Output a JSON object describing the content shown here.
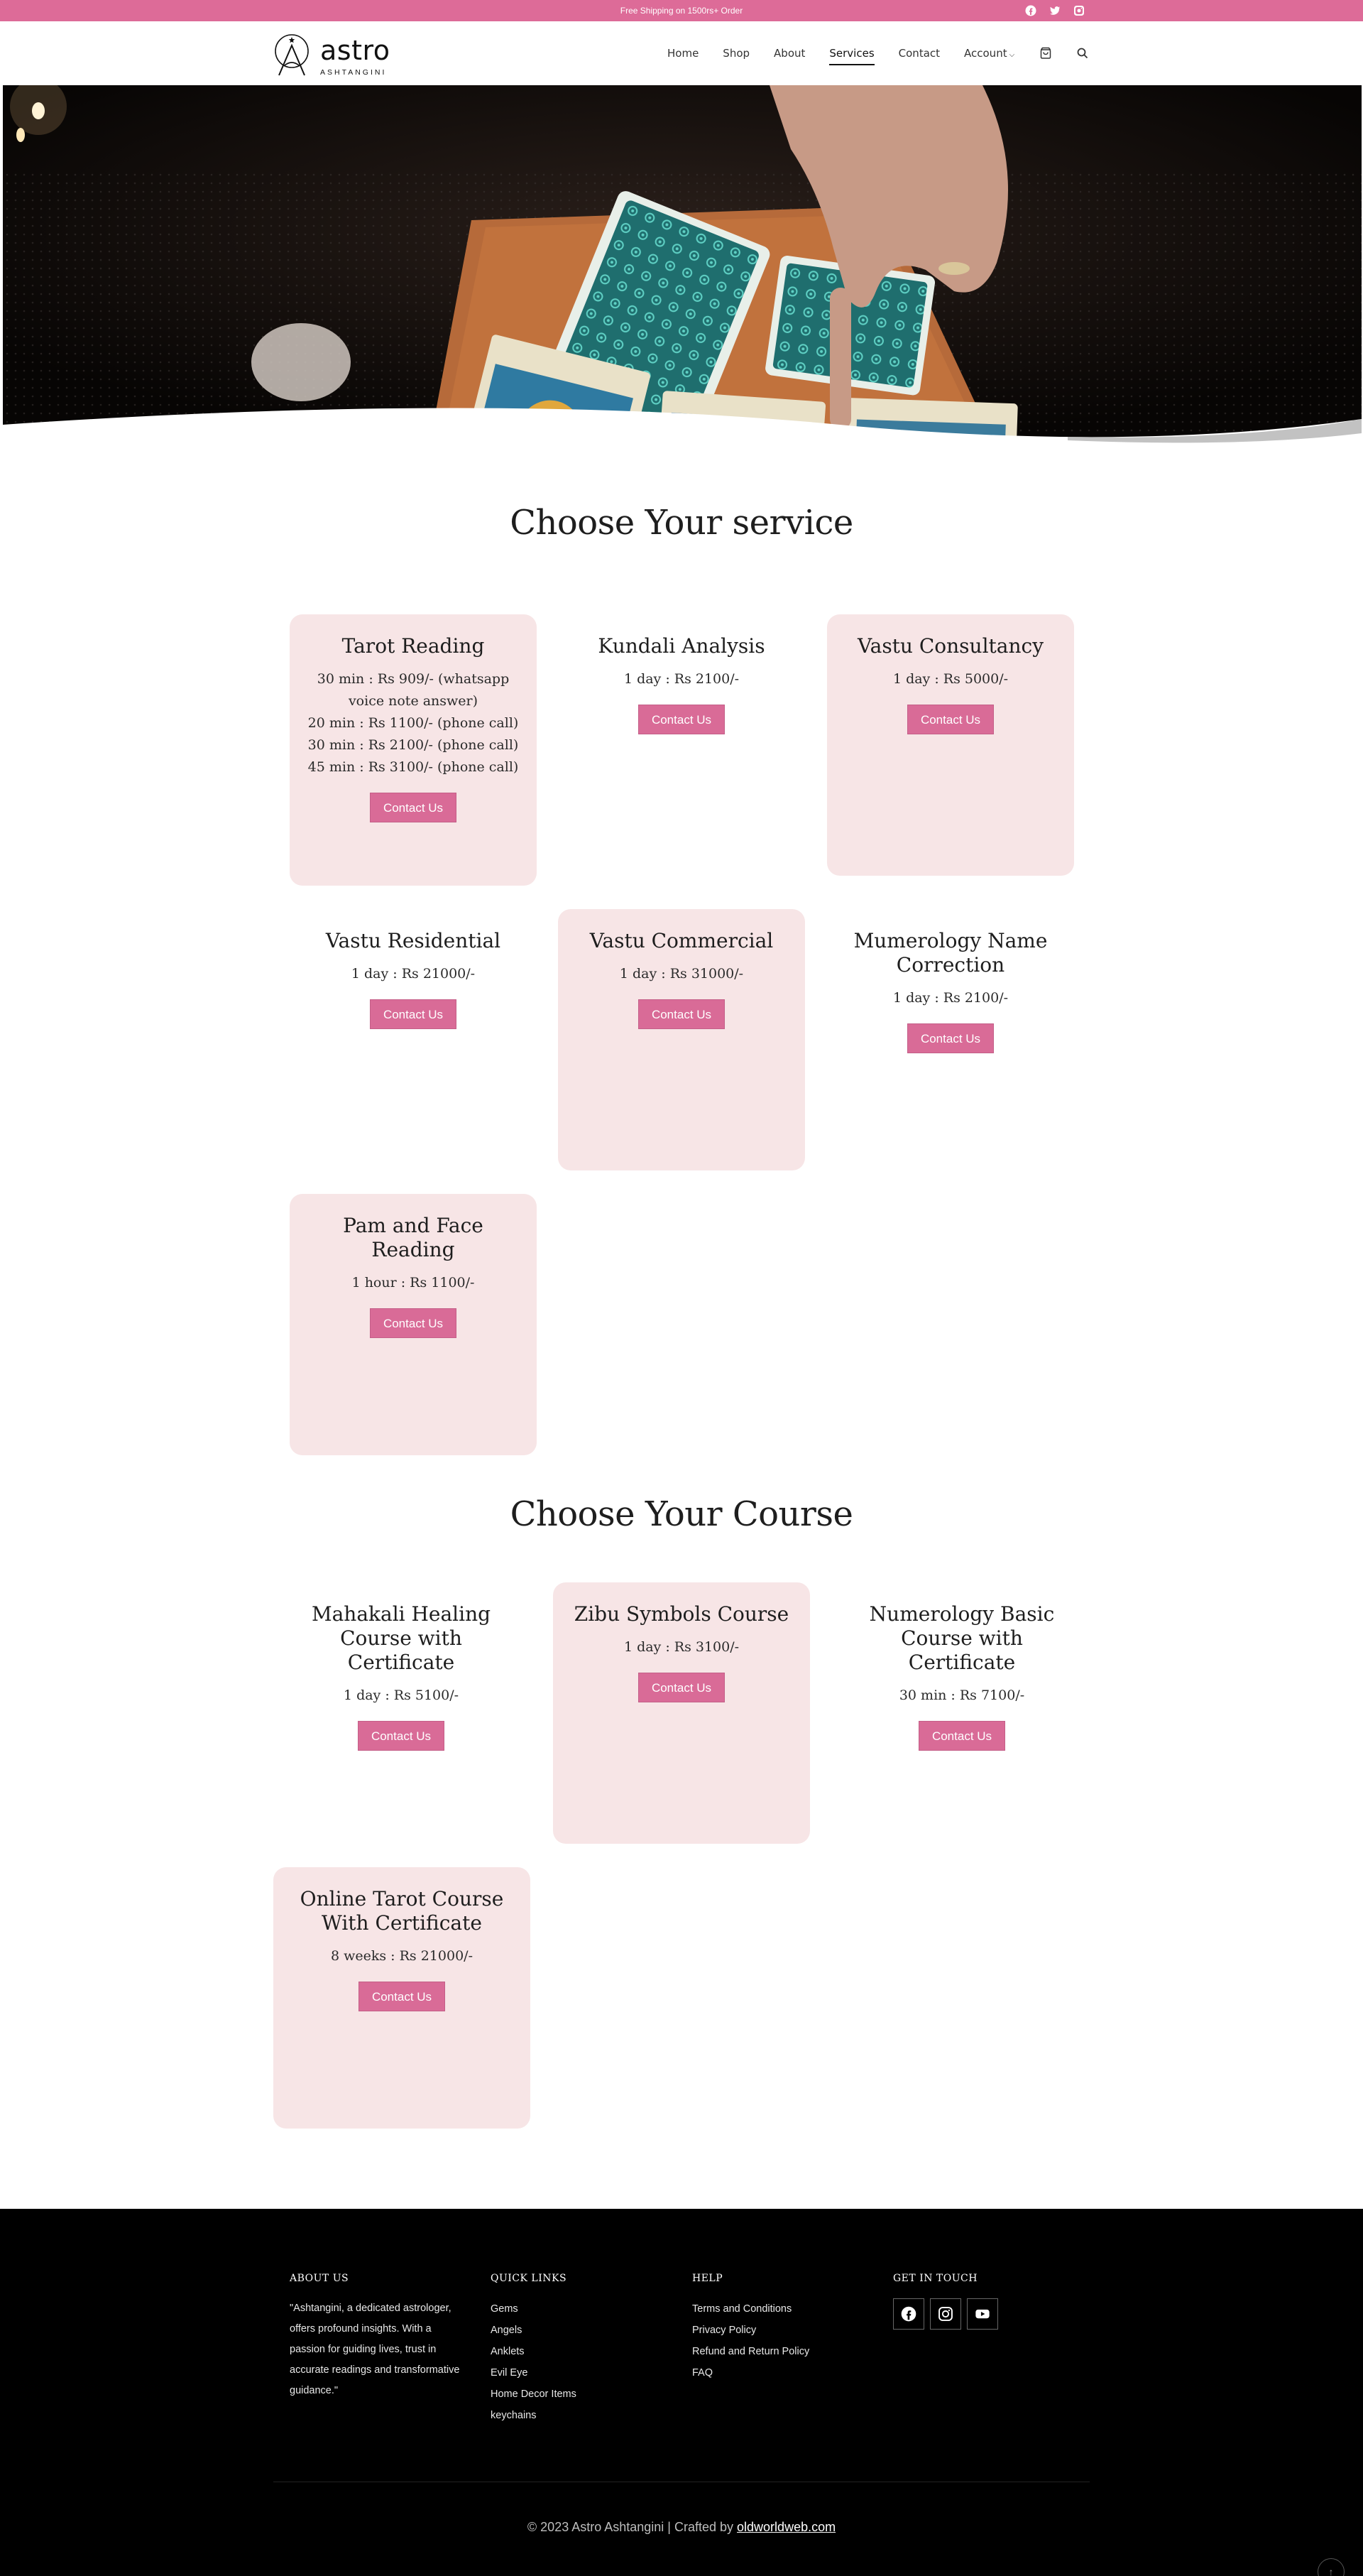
{
  "topbar": {
    "shipping_text": "Free Shipping on 1500rs+ Order",
    "socials": [
      "facebook-icon",
      "twitter-icon",
      "instagram-icon"
    ],
    "bg_color": "#dd6b98"
  },
  "header": {
    "logo_name": "astro",
    "logo_sub": "ASHTANGINI",
    "nav": [
      {
        "label": "Home"
      },
      {
        "label": "Shop"
      },
      {
        "label": "About"
      },
      {
        "label": "Services",
        "active": true
      },
      {
        "label": "Contact"
      },
      {
        "label": "Account"
      }
    ]
  },
  "services": {
    "title": "Choose Your service",
    "cards": [
      {
        "title": "Tarot Reading",
        "lines": [
          "30 min : Rs 909/- (whatsapp voice note answer)",
          "20 min : Rs 1100/- (phone call)",
          "30 min : Rs 2100/- (phone call)",
          "45 min : Rs 3100/- (phone call)"
        ],
        "button": "Contact Us"
      },
      {
        "title": "Kundali Analysis",
        "lines": [
          "1 day : Rs 2100/-"
        ],
        "button": "Contact Us"
      },
      {
        "title": "Vastu Consultancy",
        "lines": [
          "1 day : Rs 5000/-"
        ],
        "button": "Contact Us"
      },
      {
        "title": "Vastu Residential",
        "lines": [
          "1 day : Rs 21000/-"
        ],
        "button": "Contact Us"
      },
      {
        "title": "Vastu Commercial",
        "lines": [
          "1 day : Rs 31000/-"
        ],
        "button": "Contact Us"
      },
      {
        "title": "Mumerology Name Correction",
        "lines": [
          "1 day : Rs 2100/-"
        ],
        "button": "Contact Us"
      },
      {
        "title": "Pam and Face Reading",
        "lines": [
          "1 hour : Rs 1100/-"
        ],
        "button": "Contact Us"
      }
    ]
  },
  "courses": {
    "title": "Choose Your Course",
    "cards": [
      {
        "title": "Mahakali Healing Course with Certificate",
        "lines": [
          "1 day : Rs 5100/-"
        ],
        "button": "Contact Us"
      },
      {
        "title": "Zibu Symbols Course",
        "lines": [
          "1 day : Rs 3100/-"
        ],
        "button": "Contact Us"
      },
      {
        "title": "Numerology Basic Course with Certificate",
        "lines": [
          "30 min : Rs 7100/-"
        ],
        "button": "Contact Us"
      },
      {
        "title": "Online Tarot Course With Certificate",
        "lines": [
          "8 weeks : Rs 21000/-"
        ],
        "button": "Contact Us"
      }
    ]
  },
  "footer": {
    "about_title": "ABOUT US",
    "about_text": "\"Ashtangini, a dedicated astrologer, offers profound insights. With a passion for guiding lives, trust in accurate readings and transformative guidance.\"",
    "quick_title": "QUICK LINKS",
    "quick_links": [
      "Gems",
      "Angels",
      "Anklets",
      "Evil Eye",
      "Home Decor Items",
      "keychains"
    ],
    "help_title": "HELP",
    "help_links": [
      "Terms and Conditions",
      "Privacy Policy",
      "Refund and Return Policy",
      "FAQ"
    ],
    "contact_title": "GET IN TOUCH",
    "contact_socials": [
      "facebook-icon",
      "instagram-icon",
      "youtube-icon"
    ],
    "copyright": "© 2023 Astro Ashtangini | Crafted by",
    "credit_link": "oldworldweb.com"
  },
  "colors": {
    "accent": "#d96b97",
    "card_bg": "#f7e5e6",
    "footer_bg": "#000000"
  }
}
